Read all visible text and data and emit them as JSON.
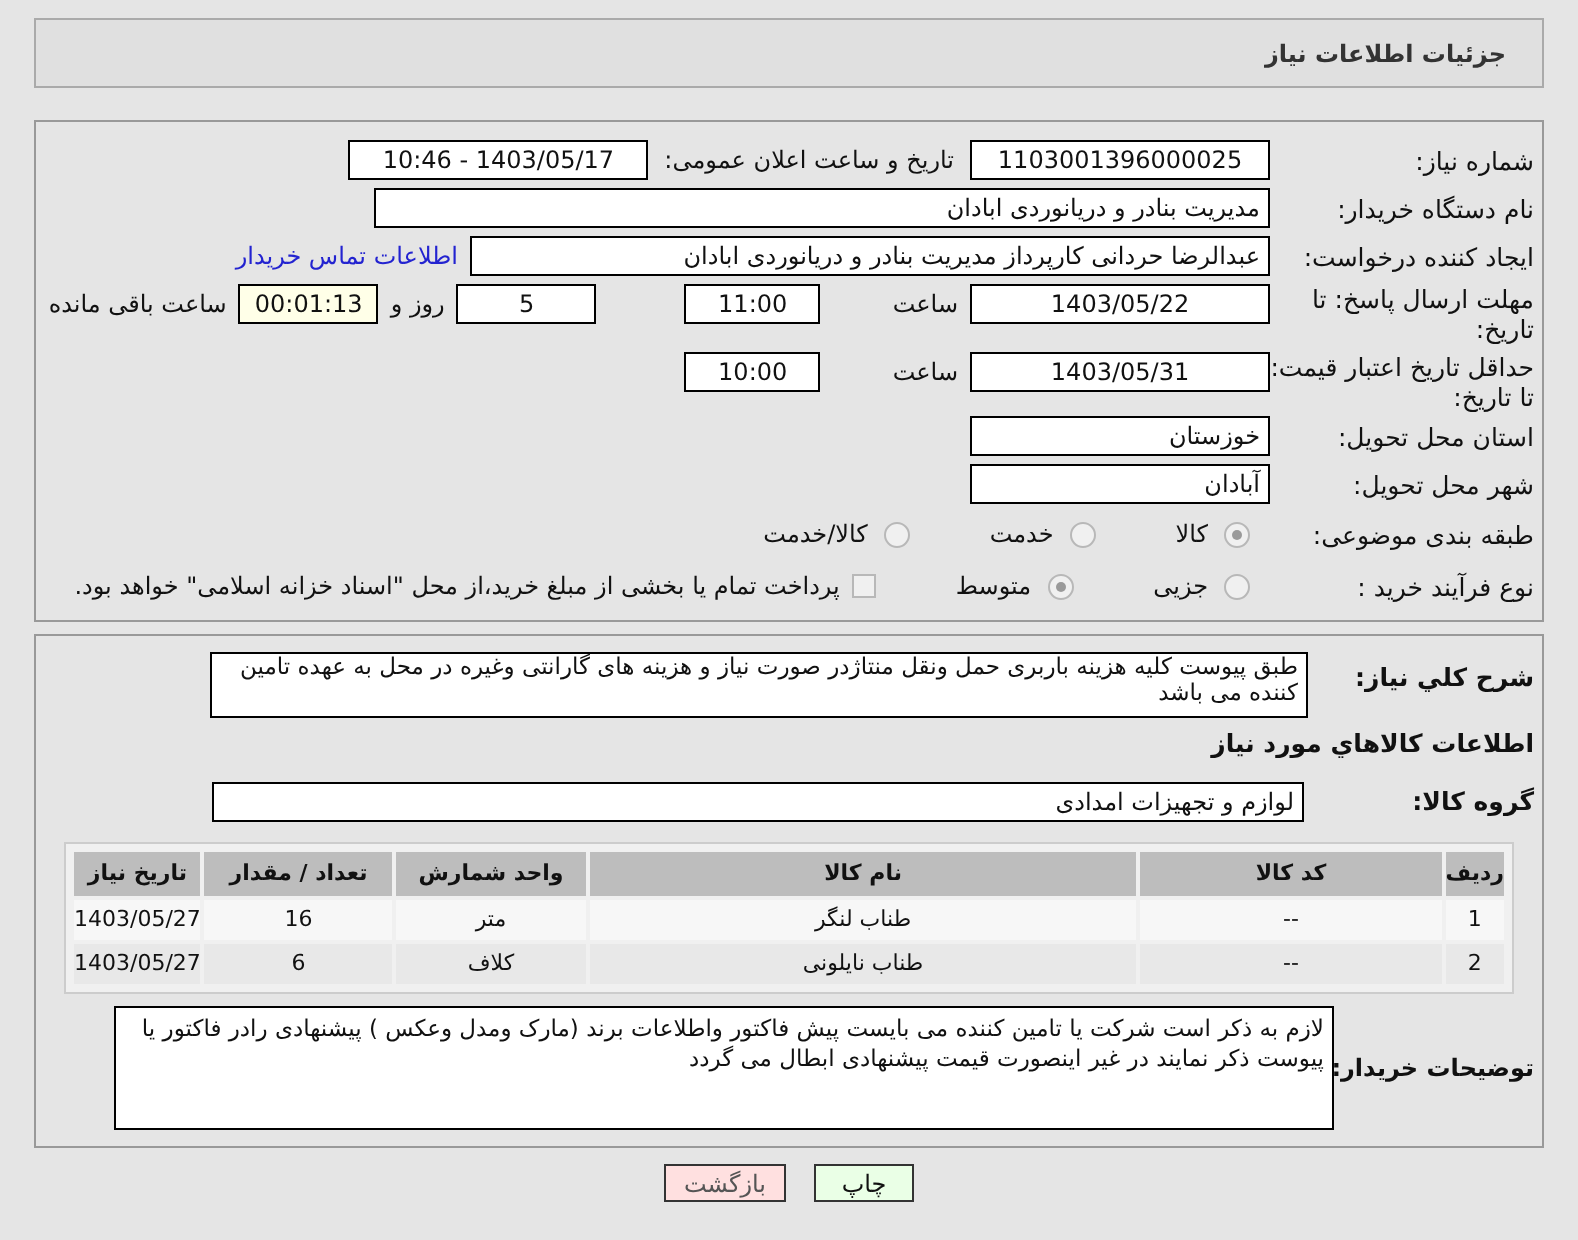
{
  "header": {
    "title": "جزئیات اطلاعات نیاز"
  },
  "fields": {
    "need_number": {
      "label": "شماره نیاز:",
      "value": "1103001396000025"
    },
    "announce": {
      "label": "تاریخ و ساعت اعلان عمومی:",
      "value": "1403/05/17 - 10:46"
    },
    "buyer_org": {
      "label": "نام دستگاه خریدار:",
      "value": "مدیریت بنادر و دریانوردی ابادان"
    },
    "requester": {
      "label": "ایجاد کننده درخواست:",
      "value": "عبدالرضا حردانی کارپرداز مدیریت بنادر و دریانوردی ابادان",
      "link": "اطلاعات تماس خریدار"
    },
    "deadline": {
      "label": "مهلت ارسال پاسخ: تا تاریخ:",
      "date": "1403/05/22",
      "time_label": "ساعت",
      "time": "11:00",
      "days": "5",
      "days_label": "روز و",
      "remaining": "00:01:13",
      "remaining_label": "ساعت باقی مانده"
    },
    "validity": {
      "label": "حداقل تاریخ اعتبار قیمت: تا تاریخ:",
      "date": "1403/05/31",
      "time_label": "ساعت",
      "time": "10:00"
    },
    "province": {
      "label": "استان محل تحویل:",
      "value": "خوزستان"
    },
    "city": {
      "label": "شهر محل تحویل:",
      "value": "آبادان"
    }
  },
  "category": {
    "label": "طبقه بندی موضوعی:",
    "options": [
      {
        "label": "کالا",
        "selected": true
      },
      {
        "label": "خدمت",
        "selected": false
      },
      {
        "label": "کالا/خدمت",
        "selected": false
      }
    ]
  },
  "process": {
    "label": "نوع فرآیند خرید :",
    "options": [
      {
        "label": "جزیی",
        "selected": false
      },
      {
        "label": "متوسط",
        "selected": true
      }
    ],
    "payment": {
      "label": "پرداخت تمام یا بخشی از مبلغ خرید،از محل \"اسناد خزانه اسلامی\" خواهد بود.",
      "checked": false
    }
  },
  "description": {
    "label": "شرح کلي نياز:",
    "value": "طبق پیوست کلیه هزینه باربری حمل ونقل منتاژدر صورت نیاز و هزینه های گارانتی  وغیره در محل به عهده تامین کننده می باشد"
  },
  "goods_heading": "اطلاعات كالاهاي مورد نياز",
  "goods_group": {
    "label": "گروه کالا:",
    "value": "لوازم و تجهیزات امدادی"
  },
  "table": {
    "columns": [
      "ردیف",
      "کد کالا",
      "نام کالا",
      "واحد شمارش",
      "تعداد / مقدار",
      "تاریخ نیاز"
    ],
    "rows": [
      [
        "1",
        "--",
        "طناب لنگر",
        "متر",
        "16",
        "1403/05/27"
      ],
      [
        "2",
        "--",
        "طناب نایلونی",
        "کلاف",
        "6",
        "1403/05/27"
      ]
    ]
  },
  "buyer_notes": {
    "label": "توضیحات خریدار:",
    "value": "لازم به ذکر است شرکت یا تامین کننده می بایست پیش  فاکتور  واطلاعات برند (مارک ومدل وعکس ) پیشنهادی رادر فاکتور یا پیوست ذکر نمایند در غیر اینصورت قیمت پیشنهادی ابطال می گردد"
  },
  "buttons": [
    {
      "label": "چاپ",
      "kind": "print"
    },
    {
      "label": "بازگشت",
      "kind": "back"
    }
  ]
}
